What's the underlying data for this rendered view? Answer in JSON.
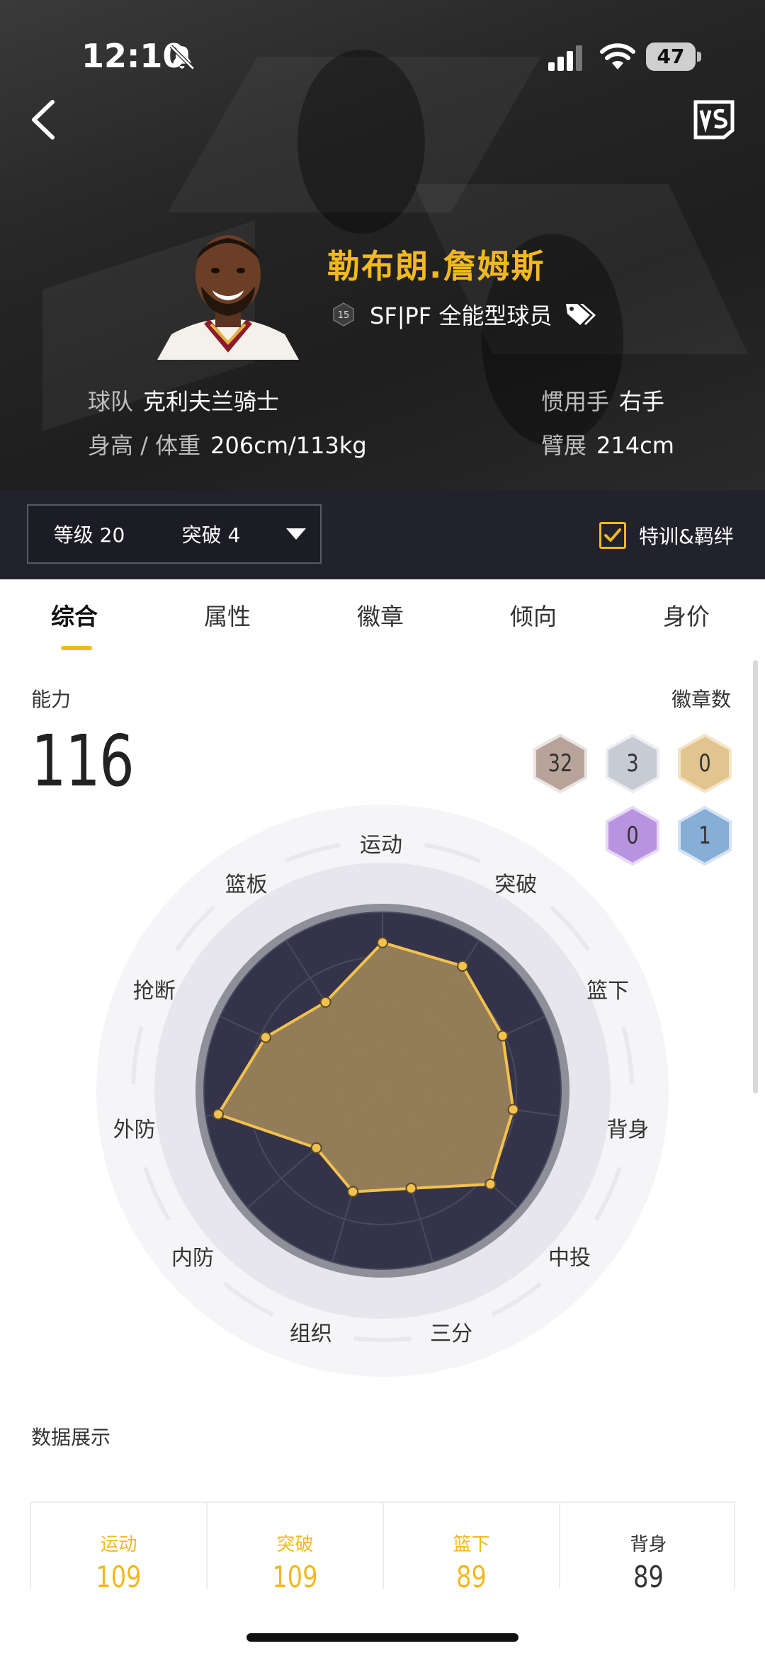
{
  "status_bar": {
    "time": "12:10",
    "battery": "47"
  },
  "player": {
    "name": "勒布朗.詹姆斯",
    "jersey_number": "15",
    "position": "SF|PF 全能型球员",
    "team_label": "球队",
    "team": "克利夫兰骑士",
    "height_weight_label": "身高 / 体重",
    "height_weight": "206cm/113kg",
    "hand_label": "惯用手",
    "hand": "右手",
    "wingspan_label": "臂展",
    "wingspan": "214cm"
  },
  "filter": {
    "level": "等级 20",
    "breakthrough": "突破 4",
    "checkbox_label": "特训&羁绊",
    "checked": true
  },
  "tabs": [
    "综合",
    "属性",
    "徽章",
    "倾向",
    "身价"
  ],
  "ability": {
    "label": "能力",
    "value": "116",
    "badge_label": "徽章数",
    "badges": [
      {
        "tier": "bronze",
        "count": "32",
        "color": "#b8a39a"
      },
      {
        "tier": "silver",
        "count": "3",
        "color": "#c6cbd6"
      },
      {
        "tier": "gold",
        "count": "0",
        "color": "#e2c48e"
      },
      {
        "tier": "hall-of-fame",
        "count": "0",
        "color": "#b894e0"
      },
      {
        "tier": "legend",
        "count": "1",
        "color": "#86aed6"
      }
    ]
  },
  "radar": {
    "axes": [
      "运动",
      "突破",
      "篮下",
      "背身",
      "中投",
      "三分",
      "组织",
      "内防",
      "外防",
      "抢断",
      "篮板"
    ],
    "values": [
      0.83,
      0.83,
      0.74,
      0.74,
      0.8,
      0.57,
      0.59,
      0.49,
      0.93,
      0.72,
      0.59
    ],
    "fill_color": "#9b8259",
    "line_color": "#f2c14e"
  },
  "stats": {
    "title": "数据展示",
    "items": [
      {
        "name": "运动",
        "value": "109",
        "highlight": true
      },
      {
        "name": "突破",
        "value": "109",
        "highlight": true
      },
      {
        "name": "篮下",
        "value": "89",
        "highlight": true
      },
      {
        "name": "背身",
        "value": "89",
        "highlight": false
      }
    ]
  },
  "colors": {
    "accent": "#f2b91f",
    "header_bg": "#262626",
    "filter_bg": "#22222c"
  }
}
